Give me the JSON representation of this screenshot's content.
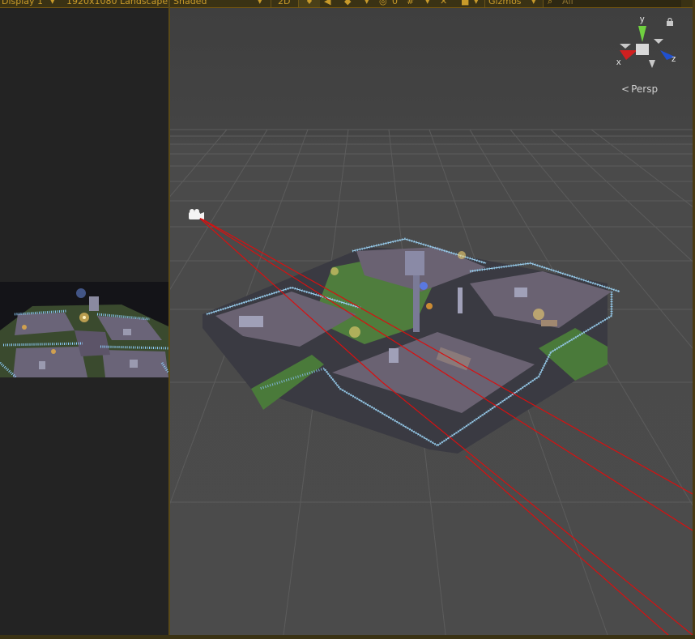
{
  "toolbar": {
    "display": "Display 1",
    "resolution": "1920x1080 Landscape",
    "draw_mode": "Shaded",
    "mode_2d": "2D",
    "fx_count": "0",
    "gizmos": "Gizmos",
    "search_placeholder": "All"
  },
  "scene": {
    "projection": "Persp",
    "axes": {
      "x": "x",
      "y": "y",
      "z": "z"
    }
  },
  "colors": {
    "grid": "#5a5a5a",
    "sky": "#3e3e3e",
    "camera_frustum": "#d81010",
    "fence": "#7fb3d8",
    "grass": "#4a7a3a",
    "ground": "#6a6272",
    "accent": "#c89a2a"
  }
}
